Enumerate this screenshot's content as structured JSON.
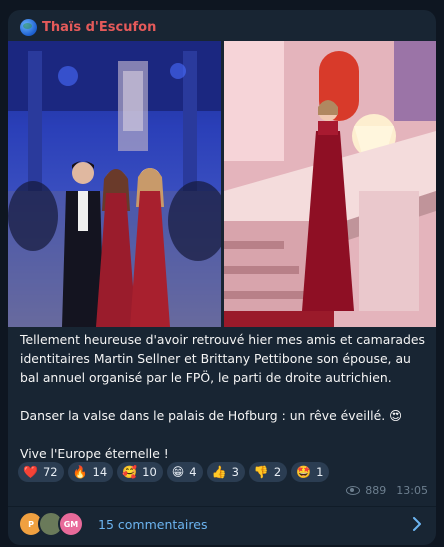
{
  "post": {
    "channel_name": "Thaïs d'Escufon",
    "paragraphs": [
      "Tellement heureuse d'avoir retrouvé hier mes amis et camarades identitaires Martin Sellner et Brittany Pettibone son épouse, au bal annuel organisé par le FPÖ, le parti de droite autrichien.",
      "Danser la valse dans le palais de Hofburg : un rêve éveillé. 😍",
      "Vive l'Europe éternelle !"
    ],
    "views": "889",
    "time": "13:05"
  },
  "reactions": [
    {
      "emoji": "❤️",
      "count": "72"
    },
    {
      "emoji": "🔥",
      "count": "14"
    },
    {
      "emoji": "🥰",
      "count": "10"
    },
    {
      "emoji": "😁",
      "count": "4"
    },
    {
      "emoji": "👍",
      "count": "3"
    },
    {
      "emoji": "👎",
      "count": "2"
    },
    {
      "emoji": "🤩",
      "count": "1"
    }
  ],
  "comments": {
    "label": "15 commentaires",
    "avatars": [
      {
        "initials": "P",
        "color": "#f0a040"
      },
      {
        "initials": "",
        "color": "#6a7a5a"
      },
      {
        "initials": "GM",
        "color": "#e86a9a"
      }
    ]
  },
  "colors": {
    "background": "#0e1621",
    "bubble": "#182533",
    "channel_name": "#e55a5a",
    "link": "#6cb4f0",
    "reaction_chip": "#2b3d52"
  },
  "icons": [
    "globe-icon",
    "eye-icon",
    "chevron-right-icon"
  ]
}
